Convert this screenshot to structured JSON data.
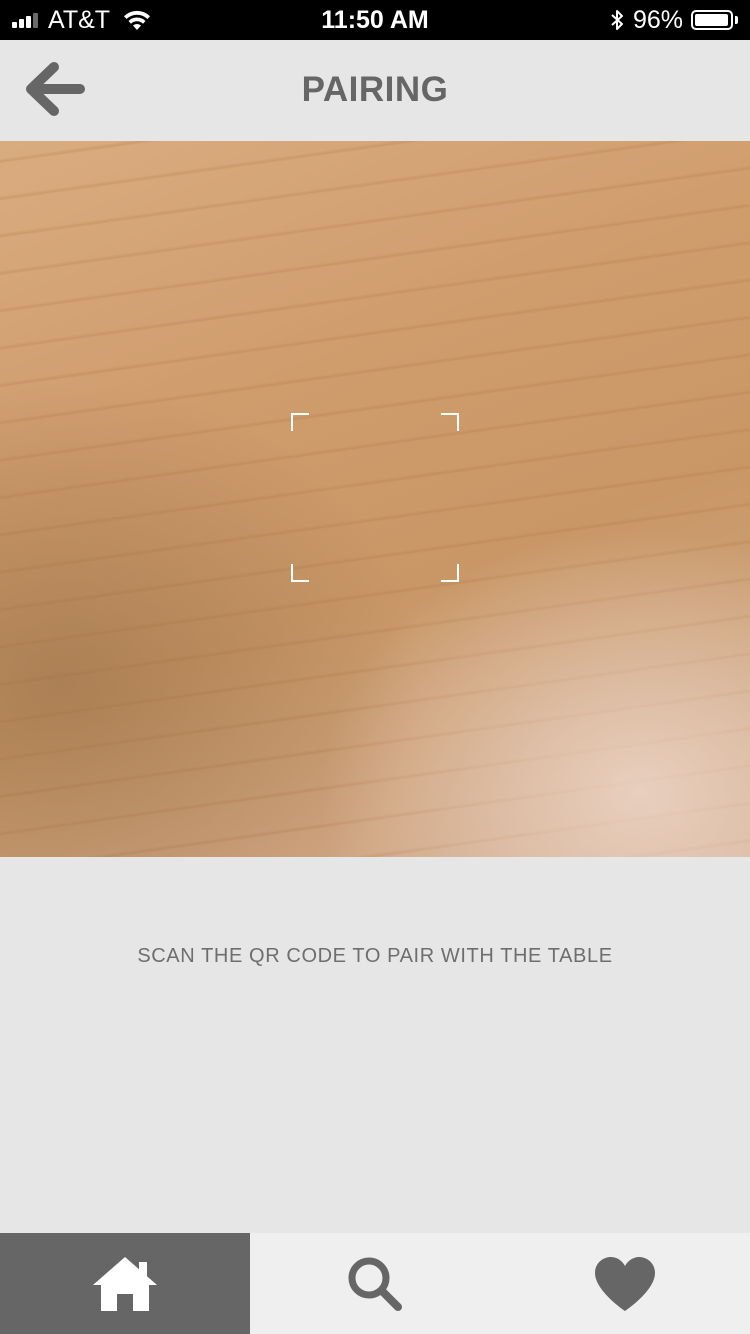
{
  "status_bar": {
    "carrier": "AT&T",
    "time": "11:50 AM",
    "battery_percent": "96%",
    "battery_level": 0.96,
    "icons": [
      "signal-icon",
      "wifi-icon",
      "bluetooth-icon",
      "battery-icon"
    ]
  },
  "header": {
    "title": "PAIRING",
    "back_icon": "back-arrow-icon"
  },
  "scanner": {
    "frame_icon": "qr-scan-frame",
    "instructions": "SCAN THE QR CODE TO PAIR WITH THE TABLE"
  },
  "tab_bar": {
    "tabs": [
      {
        "icon": "home-icon",
        "active": true
      },
      {
        "icon": "search-icon",
        "active": false
      },
      {
        "icon": "heart-icon",
        "active": false
      }
    ]
  },
  "colors": {
    "header_background": "#e6e6e6",
    "title_text": "#666666",
    "active_tab": "#666666",
    "tab_bar_background": "#efefef",
    "status_bar": "#000000"
  }
}
